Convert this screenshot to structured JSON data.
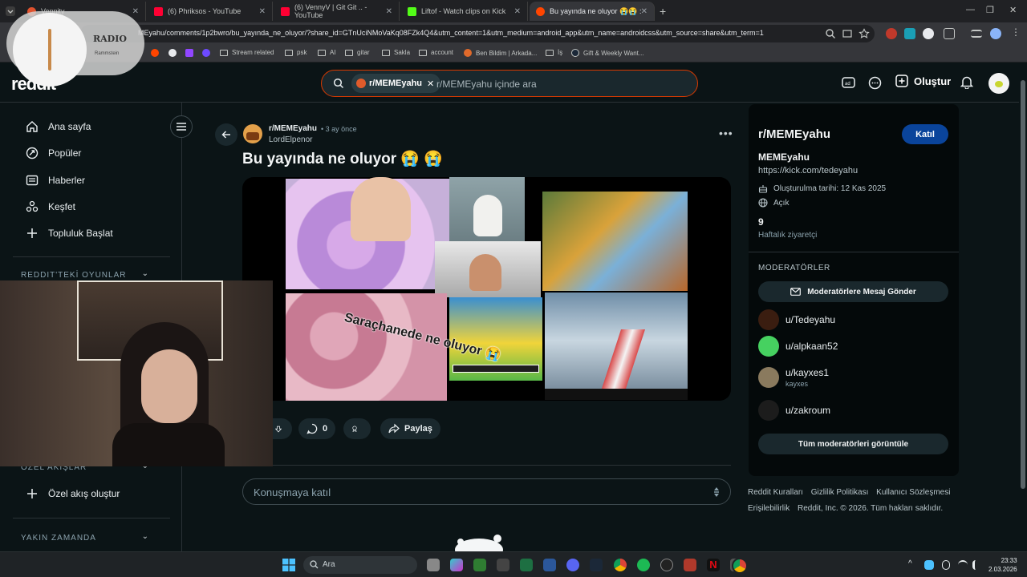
{
  "browser": {
    "tabs": [
      {
        "title": "Vennity",
        "color": "#e0522e"
      },
      {
        "title": "(6) Phriksos - YouTube",
        "color": "#ff0033"
      },
      {
        "title": "(6) VennyV | Git Git .. - YouTube",
        "color": "#ff0033"
      },
      {
        "title": "Liftof - Watch clips on Kick",
        "color": "#53fc18"
      },
      {
        "title": "Bu yayında ne oluyor 😭😭 : r/",
        "color": "#ff4500"
      }
    ],
    "new_tab": "+",
    "url": "MEyahu/comments/1p2bwro/bu_yayında_ne_oluyor/?share_id=GTnUciNMoVaKq08FZk4Q4&utm_content=1&utm_medium=android_app&utm_name=androidcss&utm_source=share&utm_term=1",
    "bookmarks": [
      "Stream related",
      "psk",
      "AI",
      "gitar",
      "Sakla",
      "account",
      "Ben Bildim | Arkada...",
      "İş",
      "Gift & Weekly Want..."
    ]
  },
  "reddit": {
    "logo": "reddit",
    "search": {
      "chip": "r/MEMEyahu",
      "placeholder": "r/MEMEyahu içinde ara"
    },
    "create_label": "Oluştur"
  },
  "sidebar": {
    "nav": [
      "Ana sayfa",
      "Popüler",
      "Haberler",
      "Keşfet",
      "Topluluk Başlat"
    ],
    "sections": [
      "REDDIT'TEKİ OYUNLAR",
      "ÖZEL AKIŞLAR",
      "YAKIN ZAMANDA"
    ],
    "custom_feed": "Özel akış oluştur"
  },
  "post": {
    "subreddit": "r/MEMEyahu",
    "time": "• 3 ay önce",
    "author": "LordElpenor",
    "title": "Bu yayında ne oluyor 😭 😭",
    "overlay_text": "Saraçhanede ne oluyor 😭",
    "comments": "0",
    "share": "Paylaş",
    "comment_placeholder": "Konuşmaya katıl"
  },
  "community": {
    "name": "r/MEMEyahu",
    "join": "Katıl",
    "title": "MEMEyahu",
    "link": "https://kick.com/tedeyahu",
    "created": "Oluşturulma tarihi: 12 Kas 2025",
    "visibility": "Açık",
    "weekly_count": "9",
    "weekly_label": "Haftalık ziyaretçi",
    "mods_heading": "MODERATÖRLER",
    "message_mods": "Moderatörlere Mesaj Gönder",
    "moderators": [
      {
        "name": "u/Tedeyahu",
        "sub": ""
      },
      {
        "name": "u/alpkaan52",
        "sub": ""
      },
      {
        "name": "u/kayxes1",
        "sub": "kayxes"
      },
      {
        "name": "u/zakroum",
        "sub": ""
      }
    ],
    "view_all": "Tüm moderatörleri görüntüle"
  },
  "footer": {
    "links1": [
      "Reddit Kuralları",
      "Gizlilik Politikası",
      "Kullanıcı Sözleşmesi"
    ],
    "links2": [
      "Erişilebilirlik",
      "Reddit, Inc. © 2026. Tüm hakları saklıdır."
    ]
  },
  "radio": {
    "title": "RADIO",
    "subtitle": "Rammstein"
  },
  "taskbar": {
    "search": "Ara",
    "time": "23:33",
    "date": "2.03.2026"
  }
}
